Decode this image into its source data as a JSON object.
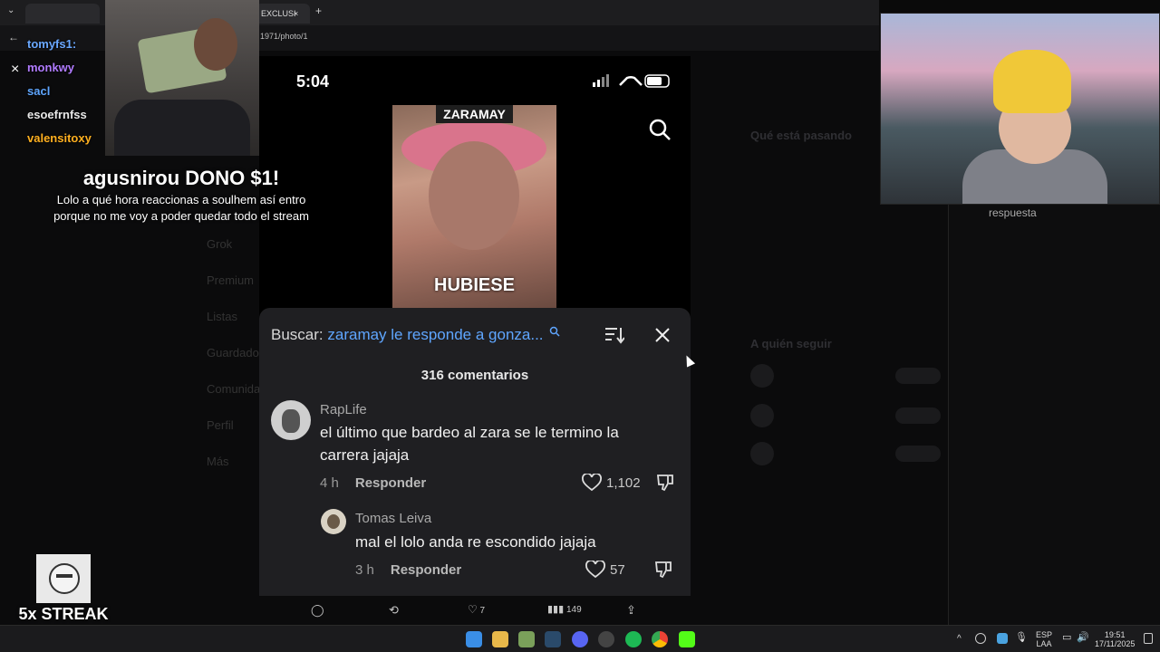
{
  "browser": {
    "tab_label": "EXCLUSI",
    "address_fragment": "1971/photo/1",
    "close_label": "×",
    "new_tab_label": "+"
  },
  "background_page": {
    "nav": [
      "Grok",
      "Premium",
      "Listas",
      "Guardados",
      "Comunidades",
      "Perfil",
      "Más"
    ],
    "right_title": "Qué está pasando",
    "right_follow": "A quién seguir",
    "follow_label": "Seguir"
  },
  "phone": {
    "clock": "5:04",
    "video_caption_top": "ZARAMAY",
    "video_caption_bottom": "HUBIESE",
    "search_prefix": "Buscar:",
    "search_query": "zaramay le responde a gonza...",
    "comments_count": "316 comentarios",
    "comments": [
      {
        "user": "RapLife",
        "text_line1": "el último que bardeo al zara se le termino la",
        "text_line2": "carrera jajaja",
        "time": "4 h",
        "reply_label": "Responder",
        "likes": "1,102"
      },
      {
        "user": "Tomas Leiva",
        "text_line1": "mal el lolo anda re escondido jajaja",
        "time": "3 h",
        "reply_label": "Responder",
        "likes": "57"
      }
    ]
  },
  "tweet_actions": {
    "likes": "7",
    "views": "149"
  },
  "overlay": {
    "alert_title": "agusnirou DONO $1!",
    "alert_message_line1": "Lolo a qué hora reaccionas a soulhem así entro",
    "alert_message_line2": "porque no me voy a poder quedar todo el stream",
    "chat": [
      {
        "name": "tomyfs1:",
        "color": "#6aa8ff"
      },
      {
        "name": "monkwy",
        "color": "#b07bff"
      },
      {
        "name": "sacl",
        "color": "#5fa6ff"
      },
      {
        "name": "esoefrnfss",
        "color": "#e8e8e8"
      },
      {
        "name": "valensitoxy",
        "color": "#ffb020"
      }
    ],
    "streak_label": "5x STREAK",
    "close_icon": "×"
  },
  "right_panel": {
    "reply_label": "respuesta"
  },
  "taskbar": {
    "lang_line1": "ESP",
    "lang_line2": "LAA",
    "time": "19:51",
    "date": "17/11/2025"
  }
}
